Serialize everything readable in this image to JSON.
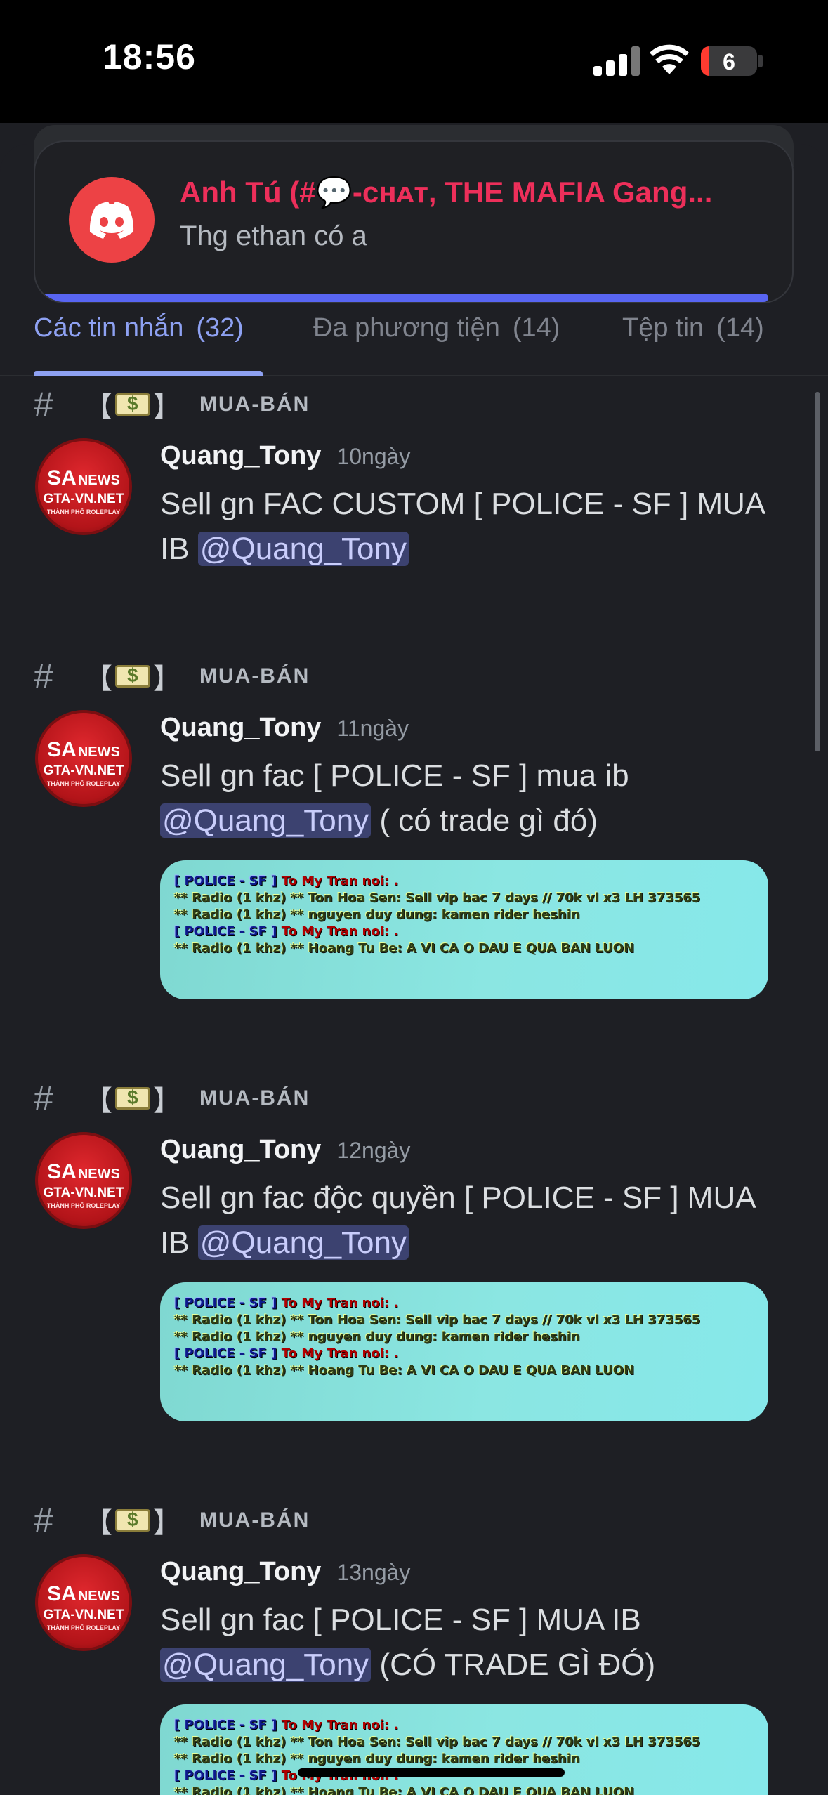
{
  "status": {
    "time": "18:56",
    "battery": "6"
  },
  "notification": {
    "title": "Anh Tú (#💬-ᴄʜᴀᴛ, THE MAFIA Gang...",
    "body": "Thg ethan có a"
  },
  "tabs": [
    {
      "label": "Các tin nhắn",
      "count": "(32)",
      "active": true
    },
    {
      "label": "Đa phương tiện",
      "count": "(14)",
      "active": false
    },
    {
      "label": "Tệp tin",
      "count": "(14)",
      "active": false
    }
  ],
  "avatar": {
    "sa": "SA",
    "news": "NEWS",
    "site": "GTA-VN.NET",
    "tagline": "THÀNH PHỐ ROLEPLAY"
  },
  "attachment_lines": {
    "l1_police": "[ POLICE - SF ]",
    "l1_rest": " To My Tran noi: .",
    "l2": "** Radio (1 khz) ** Ton Hoa Sen: Sell vip bac 7 days // 70k vl x3 LH 373565",
    "l3": "** Radio (1 khz) ** nguyen duy dung: kamen rider heshin",
    "l4_police": "[ POLICE - SF ]",
    "l4_rest": " To My Tran noi: .",
    "l5": "** Radio (1 khz) ** Hoang Tu Be: A VI CA O DAU E QUA BAN LUON"
  },
  "results": [
    {
      "channel": "MUA-BÁN",
      "author": "Quang_Tony",
      "time": "10ngày",
      "text1": "Sell gn FAC CUSTOM [ POLICE - SF ] MUA",
      "text2": "IB ",
      "mention": "@Quang_Tony",
      "text3": ""
    },
    {
      "channel": "MUA-BÁN",
      "author": "Quang_Tony",
      "time": "11ngày",
      "text1": "Sell gn fac [ POLICE - SF ] mua ib",
      "text2": "",
      "mention": "@Quang_Tony",
      "text3": " ( có trade gì đó)"
    },
    {
      "channel": "MUA-BÁN",
      "author": "Quang_Tony",
      "time": "12ngày",
      "text1": "Sell gn fac độc quyền [ POLICE - SF ] MUA",
      "text2": "IB ",
      "mention": "@Quang_Tony",
      "text3": ""
    },
    {
      "channel": "MUA-BÁN",
      "author": "Quang_Tony",
      "time": "13ngày",
      "text1": "Sell gn fac [ POLICE - SF ] MUA IB",
      "text2": "",
      "mention": "@Quang_Tony",
      "text3": " (CÓ TRADE GÌ ĐÓ)"
    }
  ]
}
